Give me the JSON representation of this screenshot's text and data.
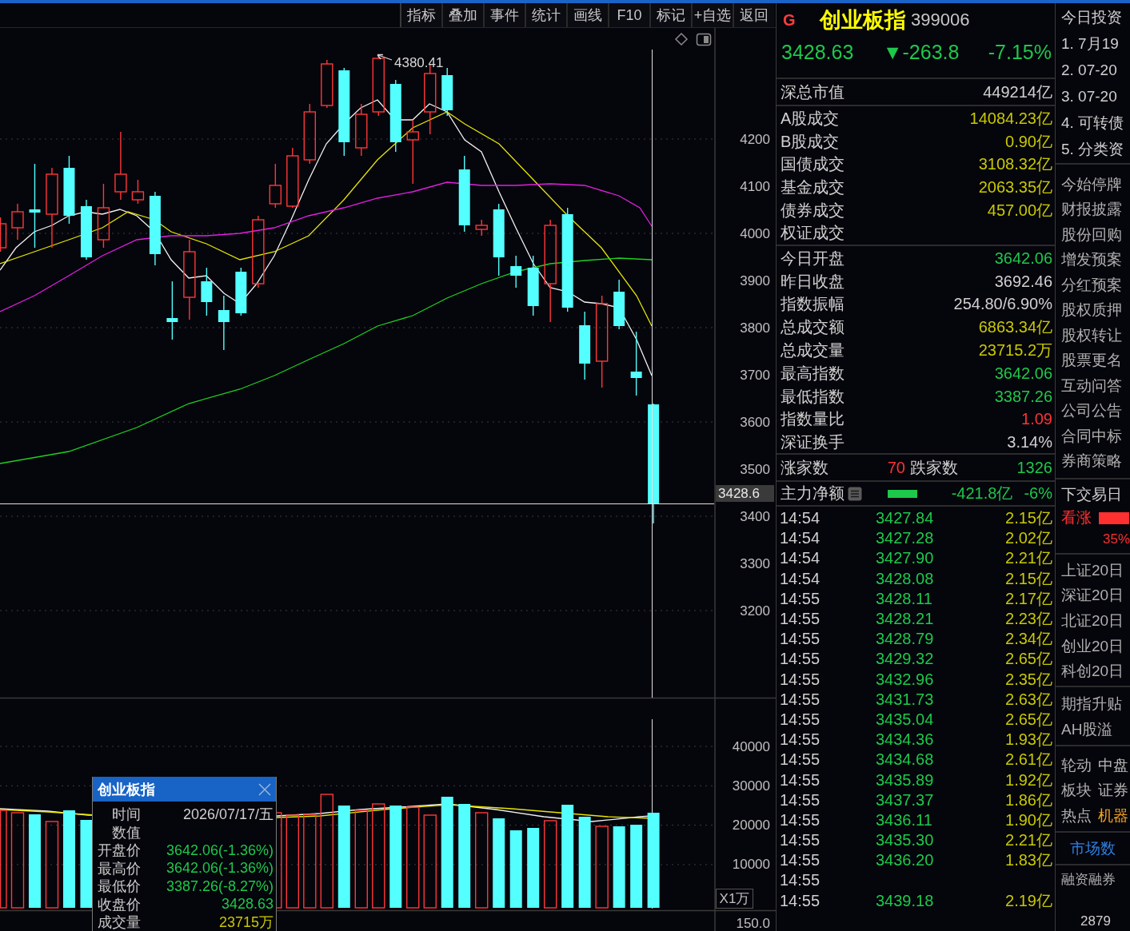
{
  "toolbar": {
    "buttons": [
      "指标",
      "叠加",
      "事件",
      "统计",
      "画线",
      "F10",
      "标记",
      "+自选",
      "返回"
    ]
  },
  "price_chart": {
    "axis_ticks": [
      "4200",
      "4100",
      "4000",
      "3900",
      "3800",
      "3700",
      "3600",
      "3500",
      "3400",
      "3300",
      "3200"
    ],
    "high_label": "4380.41",
    "current_price": "3428.6"
  },
  "volume_chart": {
    "axis_ticks": [
      "40000",
      "30000",
      "20000",
      "10000"
    ],
    "unit": "X1万"
  },
  "lower_panel": {
    "axis_tick": "150.0"
  },
  "tooltip": {
    "title": "创业板指",
    "rows": [
      {
        "label": "时间",
        "value": "2026/07/17/五",
        "color": "#d0d0d0"
      },
      {
        "label": "数值"
      },
      {
        "label": "开盘价",
        "value": "3642.06(-1.36%)",
        "color": "#1ec84a"
      },
      {
        "label": "最高价",
        "value": "3642.06(-1.36%)",
        "color": "#1ec84a"
      },
      {
        "label": "最低价",
        "value": "3387.26(-8.27%)",
        "color": "#1ec84a"
      },
      {
        "label": "收盘价",
        "value": "3428.63",
        "color": "#1ec84a"
      },
      {
        "label": "成交量",
        "value": "23715万",
        "color": "#c8c800"
      }
    ]
  },
  "quote": {
    "market_tag": "G",
    "name": "创业板指",
    "code": "399006",
    "price": "3428.63",
    "change": "▼-263.8",
    "change_percent": "-7.15%",
    "falling": true
  },
  "market_value": {
    "label": "深总市值",
    "value": "449214亿",
    "color": "#d0d0d0"
  },
  "turnover": [
    {
      "label": "A股成交",
      "value": "14084.23亿",
      "color": "#c8c800"
    },
    {
      "label": "B股成交",
      "value": "0.90亿",
      "color": "#c8c800"
    },
    {
      "label": "国债成交",
      "value": "3108.32亿",
      "color": "#c8c800"
    },
    {
      "label": "基金成交",
      "value": "2063.35亿",
      "color": "#c8c800"
    },
    {
      "label": "债券成交",
      "value": "457.00亿",
      "color": "#c8c800"
    },
    {
      "label": "权证成交"
    }
  ],
  "index_stats": [
    {
      "label": "今日开盘",
      "value": "3642.06",
      "color": "#1ec84a"
    },
    {
      "label": "昨日收盘",
      "value": "3692.46",
      "color": "#d0d0d0"
    },
    {
      "label": "指数振幅",
      "value": "254.80/6.90%",
      "color": "#d0d0d0"
    },
    {
      "label": "总成交额",
      "value": "6863.34亿",
      "color": "#c8c800"
    },
    {
      "label": "总成交量",
      "value": "23715.2万",
      "color": "#c8c800"
    },
    {
      "label": "最高指数",
      "value": "3642.06",
      "color": "#1ec84a"
    },
    {
      "label": "最低指数",
      "value": "3387.26",
      "color": "#1ec84a"
    },
    {
      "label": "指数量比",
      "value": "1.09",
      "color": "#ff3232"
    },
    {
      "label": "深证换手",
      "value": "3.14%",
      "color": "#d0d0d0"
    }
  ],
  "breadth": {
    "up_label": "涨家数",
    "up_count": "70",
    "down_label": "跌家数",
    "down_count": "1326"
  },
  "main_flow": {
    "label": "主力净额",
    "amount": "-421.8亿",
    "percent": "-6%",
    "falling": true
  },
  "ticks": [
    {
      "time": "14:54",
      "price": "3427.84",
      "volume": "2.15亿"
    },
    {
      "time": "14:54",
      "price": "3427.28",
      "volume": "2.02亿"
    },
    {
      "time": "14:54",
      "price": "3427.90",
      "volume": "2.21亿"
    },
    {
      "time": "14:54",
      "price": "3428.08",
      "volume": "2.15亿"
    },
    {
      "time": "14:55",
      "price": "3428.11",
      "volume": "2.17亿"
    },
    {
      "time": "14:55",
      "price": "3428.21",
      "volume": "2.23亿"
    },
    {
      "time": "14:55",
      "price": "3428.79",
      "volume": "2.34亿"
    },
    {
      "time": "14:55",
      "price": "3429.32",
      "volume": "2.65亿"
    },
    {
      "time": "14:55",
      "price": "3432.96",
      "volume": "2.35亿"
    },
    {
      "time": "14:55",
      "price": "3431.73",
      "volume": "2.63亿"
    },
    {
      "time": "14:55",
      "price": "3435.04",
      "volume": "2.65亿"
    },
    {
      "time": "14:55",
      "price": "3434.36",
      "volume": "1.93亿"
    },
    {
      "time": "14:55",
      "price": "3434.68",
      "volume": "2.61亿"
    },
    {
      "time": "14:55",
      "price": "3435.89",
      "volume": "1.92亿"
    },
    {
      "time": "14:55",
      "price": "3437.37",
      "volume": "1.86亿"
    },
    {
      "time": "14:55",
      "price": "3436.11",
      "volume": "1.90亿"
    },
    {
      "time": "14:55",
      "price": "3435.30",
      "volume": "2.21亿"
    },
    {
      "time": "14:55",
      "price": "3436.20",
      "volume": "1.83亿"
    },
    {
      "time": "14:55"
    },
    {
      "time": "14:55",
      "price": "3439.18",
      "volume": "2.19亿"
    }
  ],
  "side_panel": {
    "news_title": "今日投资",
    "news": [
      "1. 7月19",
      "2. 07-20",
      "3. 07-20",
      "4. 可转债",
      "5. 分类资"
    ],
    "menu": [
      "今始停牌",
      "财报披露",
      "股份回购",
      "增发预案",
      "分红预案",
      "股权质押",
      "股权转让",
      "股票更名",
      "互动问答",
      "公司公告",
      "合同中标",
      "券商策略"
    ],
    "forecast": {
      "title": "下交易日",
      "label": "看涨",
      "percent": "35%"
    },
    "index_20d": [
      "上证20日",
      "深证20日",
      "北证20日",
      "创业20日",
      "科创20日"
    ],
    "premiums": [
      "期指升贴",
      "AH股溢"
    ],
    "hot": [
      {
        "label": "轮动",
        "value": "中盘",
        "color": "#b8b8b8"
      },
      {
        "label": "板块",
        "value": "证券",
        "color": "#b8b8b8"
      },
      {
        "label": "热点",
        "value": "机器",
        "color": "#f0a020"
      }
    ],
    "market_link": "市场数",
    "margin": {
      "title": "融资融券",
      "value": "2879"
    }
  }
}
